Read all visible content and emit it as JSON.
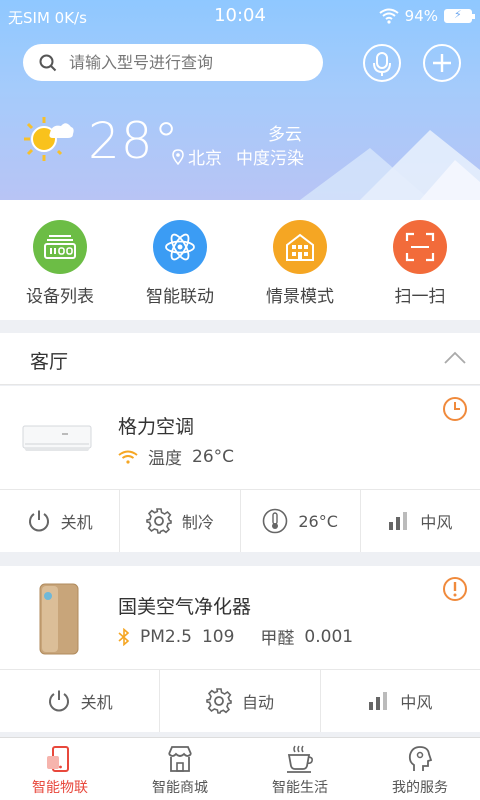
{
  "status": {
    "carrier": "无SIM 0K/s",
    "time": "10:04",
    "battery": "94%"
  },
  "search": {
    "placeholder": "请输入型号进行查询"
  },
  "weather": {
    "temperature": "28°",
    "condition": "多云",
    "city": "北京",
    "pollution": "中度污染"
  },
  "quick_menu": [
    {
      "label": "设备列表",
      "color": "#6cbd45",
      "icon": "device-list-icon"
    },
    {
      "label": "智能联动",
      "color": "#3b9cf4",
      "icon": "atom-icon"
    },
    {
      "label": "情景模式",
      "color": "#f5a623",
      "icon": "building-icon"
    },
    {
      "label": "扫一扫",
      "color": "#f26b3a",
      "icon": "scan-icon"
    }
  ],
  "room": {
    "title": "客厅"
  },
  "devices": [
    {
      "name": "格力空调",
      "info_label": "温度",
      "info_value": "26°C",
      "actions": [
        "关机",
        "制冷",
        "26°C",
        "中风"
      ]
    },
    {
      "name": "国美空气净化器",
      "pm_label": "PM2.5",
      "pm_value": "109",
      "hcho_label": "甲醛",
      "hcho_value": "0.001",
      "actions": [
        "关机",
        "自动",
        "中风"
      ]
    }
  ],
  "nav": [
    {
      "label": "智能物联",
      "active": true
    },
    {
      "label": "智能商城"
    },
    {
      "label": "智能生活"
    },
    {
      "label": "我的服务"
    }
  ],
  "colors": {
    "accent": "#e8483c",
    "warning": "#f08a3c",
    "bluetooth": "#f5a623"
  }
}
